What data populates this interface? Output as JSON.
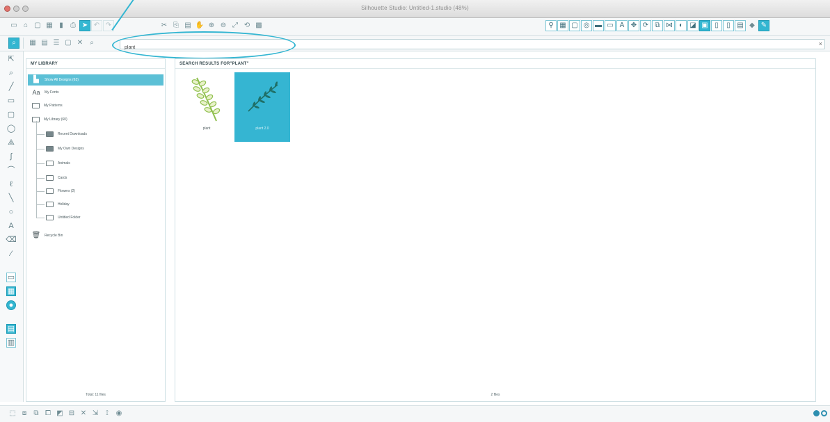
{
  "window": {
    "title": "Silhouette Studio: Untitled-1.studio (48%)"
  },
  "toolbar1": {
    "left_icons": [
      "new-document-icon",
      "open-icon",
      "save-icon",
      "library-icon",
      "store-icon",
      "print-icon",
      "send-icon",
      "undo-icon",
      "redo-icon"
    ],
    "center_icons": [
      "cut-icon",
      "copy-icon",
      "paste-icon",
      "pan-icon",
      "zoom-in-icon",
      "zoom-out-icon",
      "zoom-fit-icon",
      "rotate-icon",
      "grid-icon"
    ],
    "right_icons": [
      "page-setup-icon",
      "grid-settings-icon",
      "cut-settings-icon",
      "registration-icon",
      "fill-color-icon",
      "line-color-icon",
      "text-style-icon",
      "transform-icon",
      "replicate-icon",
      "modify-icon",
      "offset-icon",
      "trace-icon",
      "library-panel-icon",
      "send-panel-icon",
      "store-panel-icon",
      "page-icon",
      "page-alt-icon",
      "pixscan-icon",
      "eraser-icon",
      "design-icon"
    ]
  },
  "toolbar2": {
    "view_icons": [
      "library-view-icon",
      "grid-view-icon",
      "list-view-icon",
      "new-folder-icon",
      "delete-icon",
      "search-icon"
    ]
  },
  "search": {
    "value": "plant",
    "placeholder": "",
    "clear": "×"
  },
  "tools": {
    "icons": [
      "select-icon",
      "zoom-icon",
      "line-icon",
      "rectangle-icon",
      "rounded-rect-icon",
      "ellipse-icon",
      "polygon-icon",
      "curve-icon",
      "arc-icon",
      "freehand-icon",
      "smooth-freehand-icon",
      "circle-icon",
      "text-icon",
      "eraser-tool-icon",
      "knife-icon",
      "draw-icon",
      "layer-icon",
      "fill-panel-icon",
      "color-icon",
      "library-mode-icon",
      "layout-icon"
    ]
  },
  "library": {
    "header": "MY LIBRARY",
    "items": [
      {
        "label": "Show All Designs (63)",
        "icon": "all-designs-icon",
        "active": true
      },
      {
        "label": "My Fonts",
        "icon": "fonts-icon",
        "active": false
      },
      {
        "label": "My Patterns",
        "icon": "folder-icon",
        "active": false
      },
      {
        "label": "My Library (60)",
        "icon": "folder-icon",
        "active": false
      },
      {
        "label": "Recent Downloads",
        "icon": "folder-icon",
        "active": false
      },
      {
        "label": "My Own Designs",
        "icon": "folder-icon",
        "active": false
      },
      {
        "label": "Animals",
        "icon": "folder-icon",
        "active": false
      },
      {
        "label": "Cards",
        "icon": "folder-icon",
        "active": false
      },
      {
        "label": "Flowers (2)",
        "icon": "folder-icon",
        "active": false
      },
      {
        "label": "Holiday",
        "icon": "folder-icon",
        "active": false
      },
      {
        "label": "Untitled Folder",
        "icon": "folder-icon",
        "active": false
      },
      {
        "label": "Recycle Bin",
        "icon": "trash-icon",
        "active": false
      }
    ],
    "footer": "Total: 11 files"
  },
  "results": {
    "header": "SEARCH RESULTS FOR\"PLANT\"",
    "tiles": [
      {
        "label": "plant",
        "selected": false,
        "color": "#8fbf4d"
      },
      {
        "label": "plant 2.0",
        "selected": true,
        "color": "#1f6f66"
      }
    ],
    "footer": "2 files"
  },
  "bottombar": {
    "icons": [
      "select-all-icon",
      "deselect-icon",
      "group-icon",
      "ungroup-icon",
      "duplicate-icon",
      "delete-shape-icon",
      "compound-icon",
      "release-icon",
      "weld-icon",
      "settings-icon"
    ],
    "right_icons": [
      "gear-icon",
      "toggle-icon"
    ]
  },
  "colors": {
    "accent": "#34b6d2",
    "active_item": "#5cc0d6"
  }
}
